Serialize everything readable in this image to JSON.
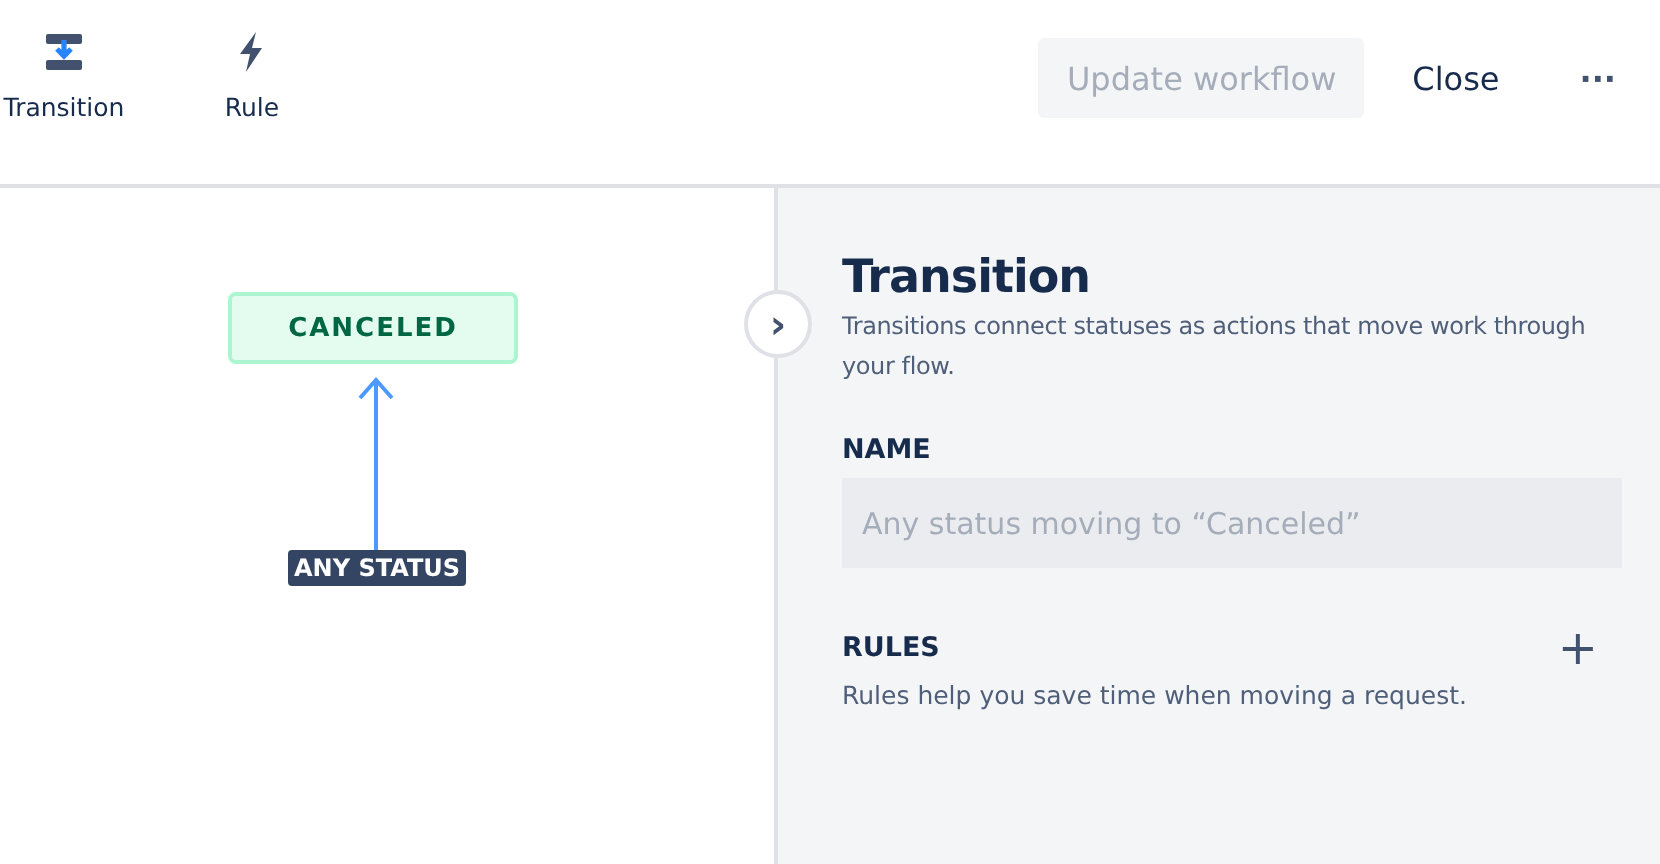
{
  "toolbar": {
    "tools": [
      {
        "label": "Transition",
        "kind": "transition"
      },
      {
        "label": "Rule",
        "kind": "rule"
      }
    ],
    "update_button": {
      "label": "Update workflow",
      "disabled": true
    },
    "close_button": {
      "label": "Close"
    },
    "more_button": {
      "label": "···"
    }
  },
  "canvas": {
    "status_node": {
      "label": "CANCELED"
    },
    "source_label": "ANY STATUS",
    "toggle_glyph": "›"
  },
  "panel": {
    "title": "Transition",
    "description": "Transitions connect statuses as actions that move work through your flow.",
    "name_label": "NAME",
    "name_field": {
      "placeholder": "Any status moving to “Canceled”"
    },
    "rules_label": "RULES",
    "add_glyph": "+",
    "rules_hint": "Rules help you save time when moving a request."
  }
}
